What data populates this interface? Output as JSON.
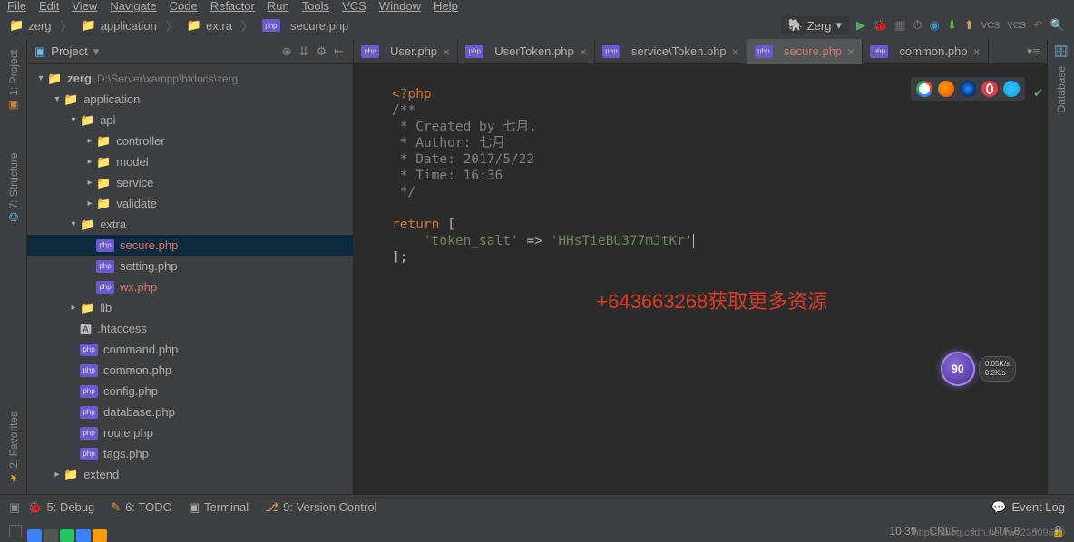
{
  "menu": [
    "File",
    "Edit",
    "View",
    "Navigate",
    "Code",
    "Refactor",
    "Run",
    "Tools",
    "VCS",
    "Window",
    "Help"
  ],
  "breadcrumb": {
    "items": [
      "zerg",
      "application",
      "extra"
    ],
    "file": "secure.php",
    "config": "Zerg"
  },
  "sidebar_left": {
    "project": "1: Project",
    "structure": "7: Structure",
    "favorites": "2: Favorites"
  },
  "project_header": {
    "title": "Project"
  },
  "tree": {
    "root_name": "zerg",
    "root_path": "D:\\Server\\xampp\\htdocs\\zerg",
    "application": "application",
    "api": "api",
    "controller": "controller",
    "model": "model",
    "service": "service",
    "validate": "validate",
    "extra": "extra",
    "secure": "secure.php",
    "setting": "setting.php",
    "wx": "wx.php",
    "lib": "lib",
    "htaccess": ".htaccess",
    "command": "command.php",
    "common": "common.php",
    "config": "config.php",
    "database": "database.php",
    "route": "route.php",
    "tags": "tags.php",
    "extend": "extend"
  },
  "tabs": {
    "t1": "User.php",
    "t2": "UserToken.php",
    "t3": "service\\Token.php",
    "t4": "secure.php",
    "t5": "common.php"
  },
  "code": {
    "l1": "<?php",
    "l2": "/**",
    "l3": " * Created by 七月.",
    "l4": " * Author: 七月",
    "l5": " * Date: 2017/5/22",
    "l6": " * Time: 16:36",
    "l7": " */",
    "l8": "",
    "l9a": "return ",
    "l9b": "[",
    "l10a": "    ",
    "l10b": "'token_salt'",
    "l10c": " => ",
    "l10d": "'HHsTieBU377mJtKr'",
    "l11": "];"
  },
  "overlay": "+643663268获取更多资源",
  "bottom": {
    "debug": "5: Debug",
    "todo": "6: TODO",
    "terminal": "Terminal",
    "vcs": "9: Version Control",
    "eventlog": "Event Log"
  },
  "status": {
    "pos": "10:39",
    "eol": "CRLF",
    "enc": "UTF-8",
    "watermark": "https://blog.csdn.net/fw_23509600"
  },
  "float": {
    "num": "90",
    "s1": "0.05K/s",
    "s2": "0.2K/s"
  },
  "sidebar_right": {
    "database": "Database"
  },
  "vcs_labels": {
    "v1": "VCS",
    "v2": "VCS"
  }
}
